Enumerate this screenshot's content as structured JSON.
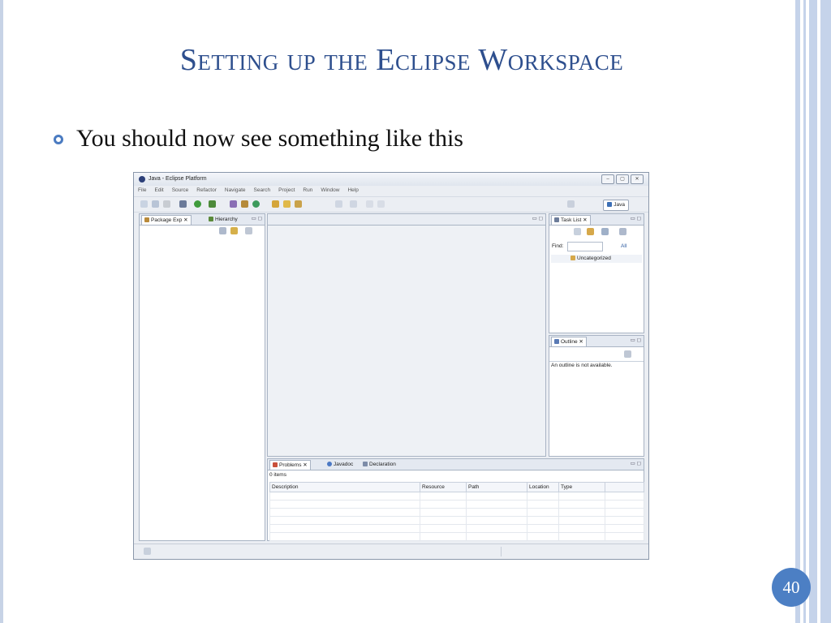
{
  "slide": {
    "title": "Setting up the Eclipse Workspace",
    "bullet": "You should now see something like this",
    "page_number": "40",
    "colors": {
      "title": "#2e4f8e",
      "accent": "#4c7fc4",
      "frame": "#c5d3ea"
    }
  },
  "eclipse": {
    "window_title": "Java - Eclipse Platform",
    "window_buttons": [
      "–",
      "▢",
      "✕"
    ],
    "menu": [
      "File",
      "Edit",
      "Source",
      "Refactor",
      "Navigate",
      "Search",
      "Project",
      "Run",
      "Window",
      "Help"
    ],
    "perspective": "Java",
    "left_tabs": [
      "Package Exp",
      "Hierarchy"
    ],
    "task_list": {
      "tab": "Task List",
      "find_label": "Find:",
      "all_label": "All",
      "category": "Uncategorized"
    },
    "outline": {
      "tab": "Outline",
      "message": "An outline is not available."
    },
    "bottom_tabs": [
      "Problems",
      "Javadoc",
      "Declaration"
    ],
    "problems": {
      "count": "0 items",
      "columns": [
        "Description",
        "Resource",
        "Path",
        "Location",
        "Type"
      ]
    },
    "minmax": "▭ ◻",
    "close_x": "✕",
    "icons": [
      "new-icon",
      "save-icon",
      "print-icon",
      "debug-icon",
      "run-icon",
      "external-tools-icon",
      "new-java-project-icon",
      "new-package-icon",
      "new-class-icon",
      "open-type-icon",
      "search-icon",
      "back-icon",
      "forward-icon",
      "open-perspective-icon",
      "java-perspective-icon",
      "collapse-all-icon",
      "link-editor-icon",
      "view-menu-icon",
      "fast-view-icon"
    ]
  }
}
